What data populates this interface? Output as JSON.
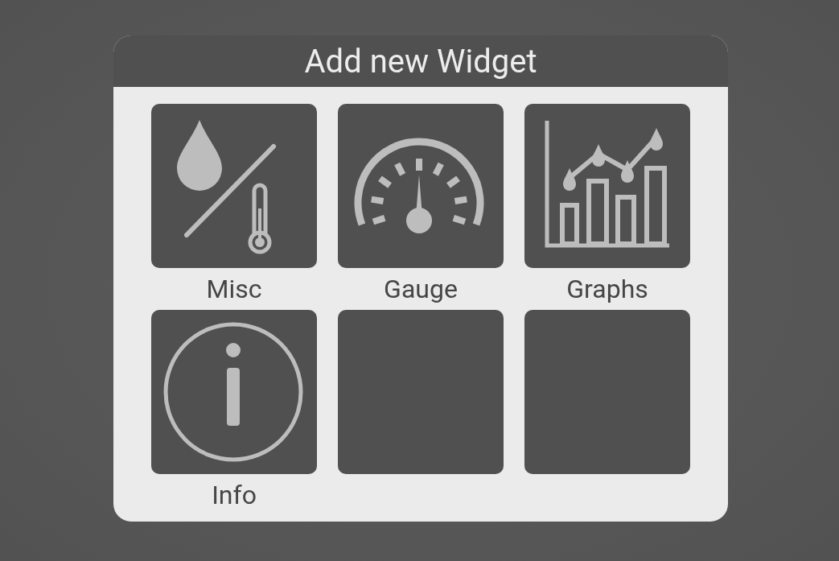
{
  "dialog": {
    "title": "Add new Widget"
  },
  "tiles": [
    {
      "kind": "widget",
      "label": "Misc"
    },
    {
      "kind": "widget",
      "label": "Gauge"
    },
    {
      "kind": "widget",
      "label": "Graphs"
    },
    {
      "kind": "widget",
      "label": "Info"
    },
    {
      "kind": "empty"
    },
    {
      "kind": "empty"
    }
  ]
}
